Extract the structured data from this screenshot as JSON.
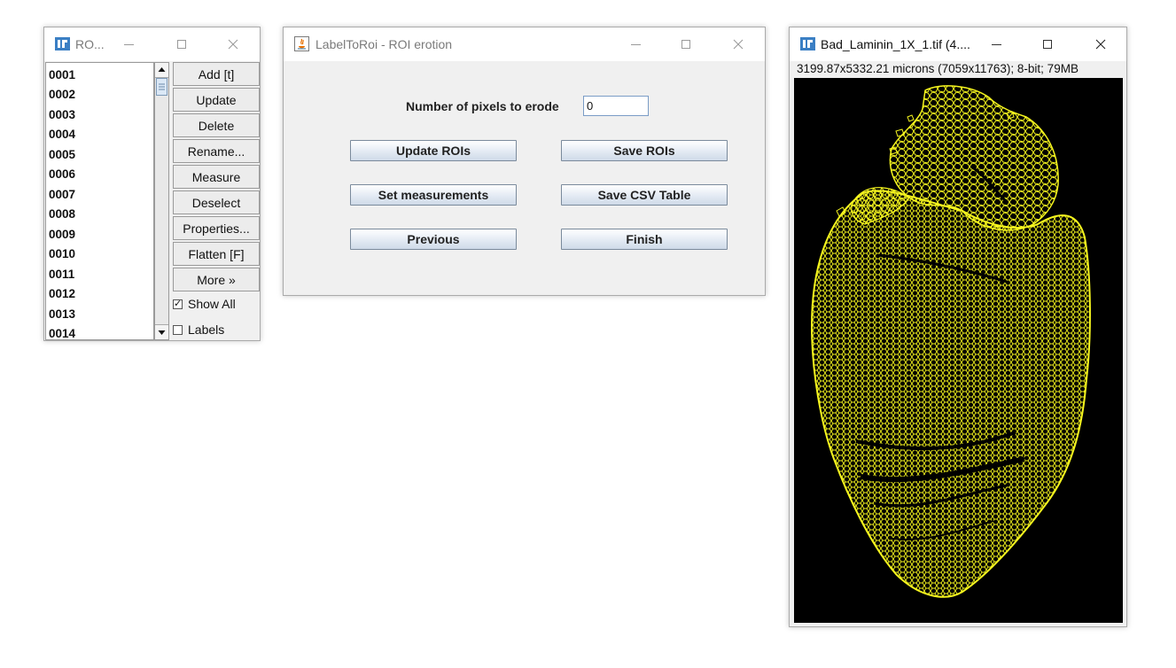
{
  "roi_manager": {
    "title": "RO...",
    "items": [
      "0001",
      "0002",
      "0003",
      "0004",
      "0005",
      "0006",
      "0007",
      "0008",
      "0009",
      "0010",
      "0011",
      "0012",
      "0013",
      "0014"
    ],
    "buttons": [
      "Add [t]",
      "Update",
      "Delete",
      "Rename...",
      "Measure",
      "Deselect",
      "Properties...",
      "Flatten [F]",
      "More »"
    ],
    "show_all_label": "Show All",
    "show_all_checked": true,
    "labels_label": "Labels",
    "labels_checked": false
  },
  "erosion_dialog": {
    "title": "LabelToRoi - ROI erotion",
    "field_label": "Number of pixels to erode",
    "field_value": "0",
    "update_rois": "Update ROIs",
    "save_rois": "Save ROIs",
    "set_measurements": "Set measurements",
    "save_csv": "Save CSV Table",
    "previous": "Previous",
    "finish": "Finish"
  },
  "image_window": {
    "title": "Bad_Laminin_1X_1.tif (4....",
    "info": "3199.87x5332.21 microns (7059x11763); 8-bit; 79MB",
    "colors": {
      "background": "#000000",
      "outlines": "#f5f51e"
    }
  }
}
